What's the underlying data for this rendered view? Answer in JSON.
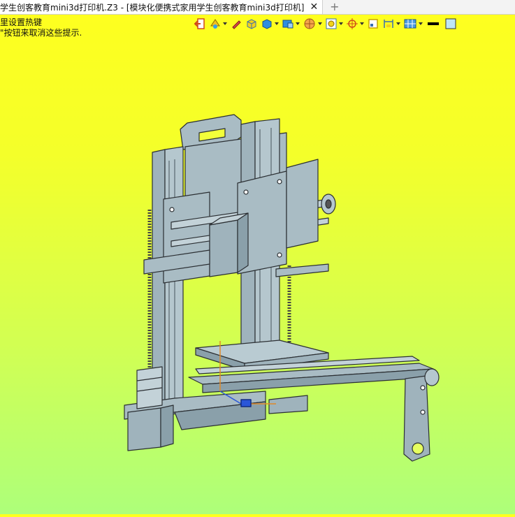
{
  "tab": {
    "title": "学生创客教育mini3d打印机.Z3 - [模块化便携式家用学生创客教育mini3d打印机]",
    "close_glyph": "✕",
    "add_glyph": "+"
  },
  "hint": {
    "line1": "里设置热键",
    "line2": "\"按钮来取消这些提示."
  },
  "toolbar": {
    "icons": [
      "exit-icon",
      "render-mode-icon",
      "pen-icon",
      "box-color-icon",
      "box-blue-icon",
      "shaded-view-icon",
      "sphere-view-icon",
      "zoom-view-icon",
      "target-icon",
      "square-icon",
      "dimension-icon",
      "grid-icon",
      "line-color-icon",
      "fill-color-icon"
    ]
  },
  "colors": {
    "background_top": "#ffff1e",
    "background_bottom": "#adff7a",
    "model_fill": "#a9bcc4",
    "model_edge": "#2b2f33"
  }
}
